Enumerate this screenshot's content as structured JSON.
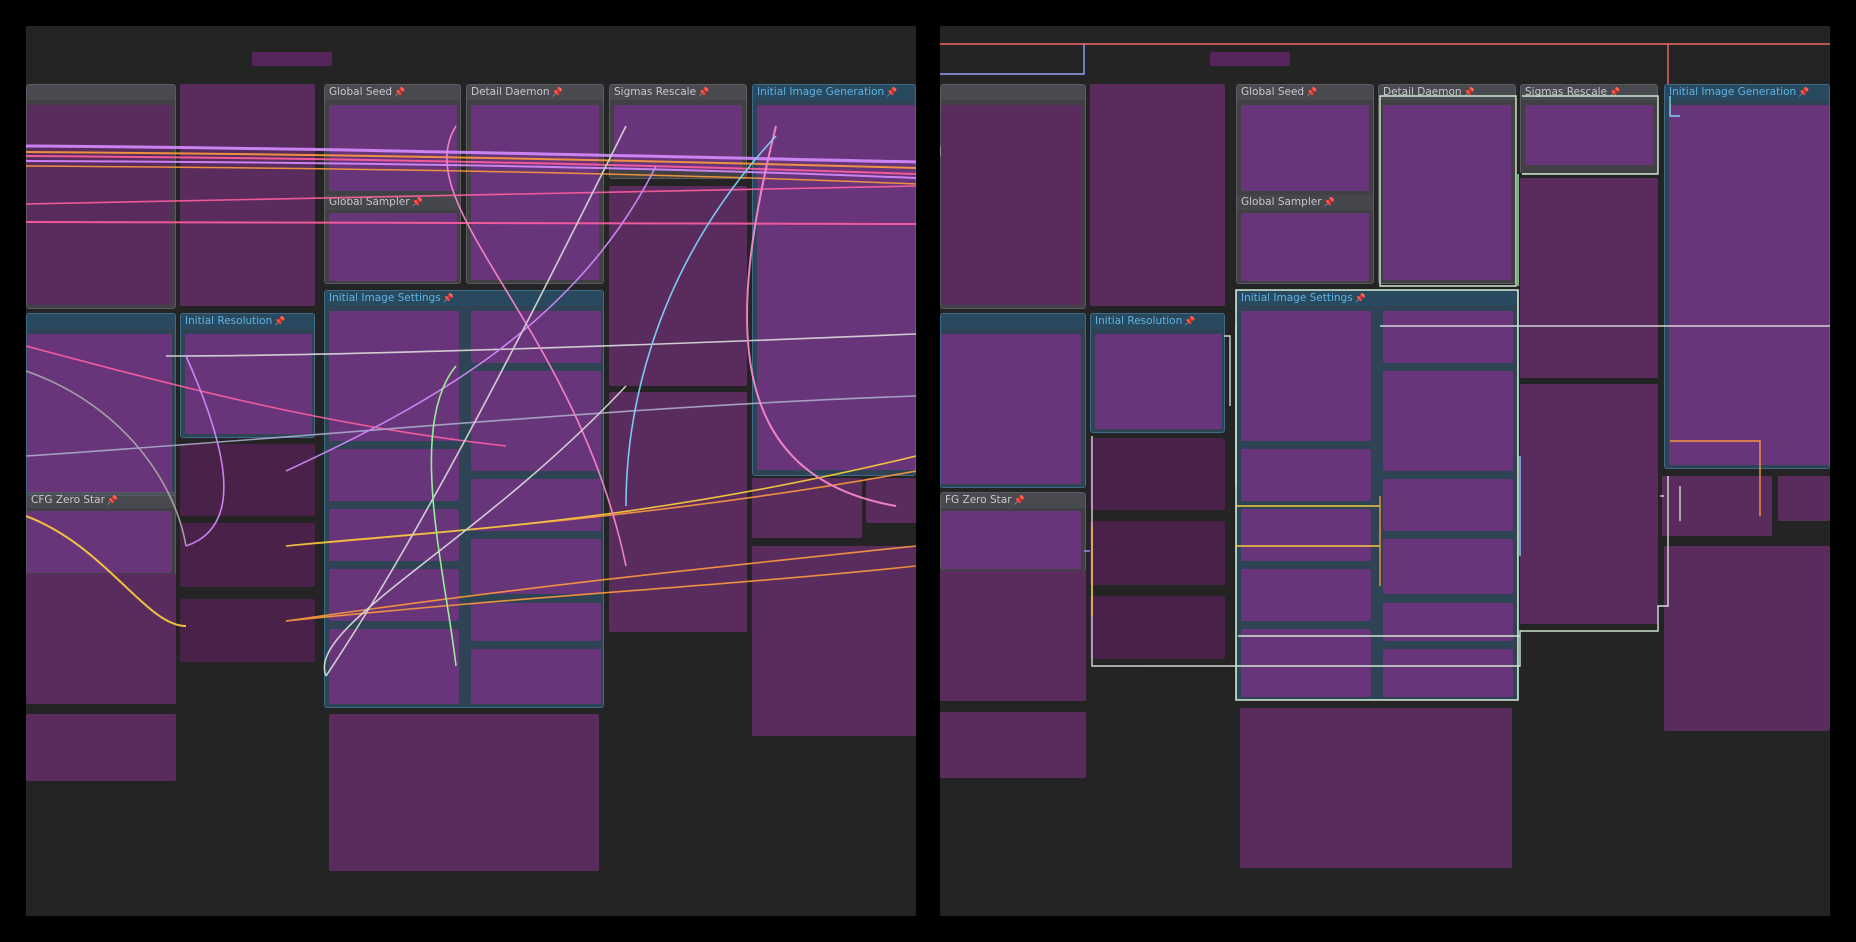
{
  "labels": {
    "global_seed": "Global Seed",
    "detail_daemon": "Detail Daemon",
    "sigmas_rescale": "Sigmas Rescale",
    "initial_image_generation": "Initial Image Generation",
    "global_sampler": "Global Sampler",
    "initial_image_settings": "Initial Image Settings",
    "initial_resolution": "Initial Resolution",
    "cfg_zero_star_left": "CFG Zero Star",
    "cfg_zero_star_right": "FG Zero Star"
  },
  "icons": {
    "pin": "pin-icon"
  },
  "colors": {
    "background": "#242424",
    "node": "#5a2c5e",
    "group_gray": "#64646e",
    "group_blue": "#375f7d",
    "accent_title": "#5fb3e6",
    "pin": "#ff4a6e",
    "wire_pink": "#ff5fa0",
    "wire_violet": "#d68cff",
    "wire_orange": "#ff9a3c",
    "wire_yellow": "#ffd23c",
    "wire_green": "#9cff9c",
    "wire_cyan": "#7fdcff",
    "wire_white": "#dddddd"
  }
}
